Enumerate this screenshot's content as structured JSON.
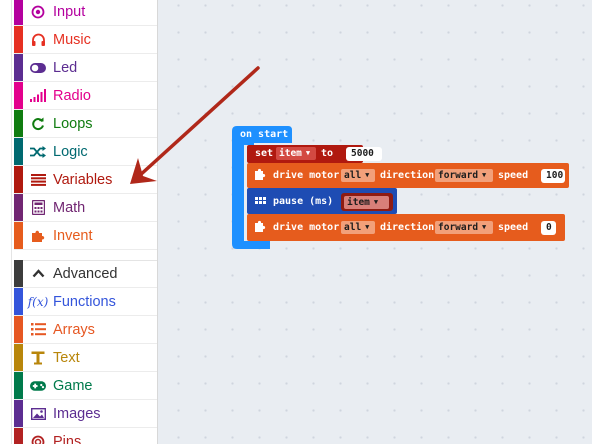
{
  "toolbox": {
    "categories": [
      {
        "label": "Input",
        "icon": "circle-dot-icon",
        "color": "#b4009e"
      },
      {
        "label": "Music",
        "icon": "headphones-icon",
        "color": "#e63022"
      },
      {
        "label": "Led",
        "icon": "toggle-icon",
        "color": "#5c2d91"
      },
      {
        "label": "Radio",
        "icon": "signal-bars-icon",
        "color": "#e3008c"
      },
      {
        "label": "Loops",
        "icon": "refresh-icon",
        "color": "#107c10"
      },
      {
        "label": "Logic",
        "icon": "shuffle-icon",
        "color": "#006970"
      },
      {
        "label": "Variables",
        "icon": "lines-icon",
        "color": "#b0190f"
      },
      {
        "label": "Math",
        "icon": "calculator-icon",
        "color": "#712672"
      },
      {
        "label": "Invent",
        "icon": "puzzle-icon",
        "color": "#e65c1d"
      }
    ],
    "advanced": [
      {
        "label": "Advanced",
        "icon": "chevron-up-icon",
        "color": "#3c3c3c"
      },
      {
        "label": "Functions",
        "icon": "function-icon",
        "color": "#3455db"
      },
      {
        "label": "Arrays",
        "icon": "list-icon",
        "color": "#e65722"
      },
      {
        "label": "Text",
        "icon": "text-t-icon",
        "color": "#b8860b"
      },
      {
        "label": "Game",
        "icon": "gamepad-icon",
        "color": "#007a4b"
      },
      {
        "label": "Images",
        "icon": "image-icon",
        "color": "#5c2d91"
      },
      {
        "label": "Pins",
        "icon": "pin-icon",
        "color": "#b22222"
      }
    ]
  },
  "colors": {
    "event": "#1e90ff",
    "variable": "#b0190f",
    "invent": "#e65c1d",
    "basic": "#1e4cb3",
    "annotation": "#b0281a"
  },
  "blocks": {
    "hat_label": "on start",
    "set": {
      "keyword": "set",
      "variable": "item",
      "to": "to",
      "value": "5000"
    },
    "motor1": {
      "label": "drive motor",
      "motor": "all",
      "direction_label": "direction",
      "direction": "forward",
      "speed_label": "speed",
      "speed": "100"
    },
    "pause": {
      "label": "pause (ms)",
      "variable": "item"
    },
    "motor2": {
      "label": "drive motor",
      "motor": "all",
      "direction_label": "direction",
      "direction": "forward",
      "speed_label": "speed",
      "speed": "0"
    }
  }
}
